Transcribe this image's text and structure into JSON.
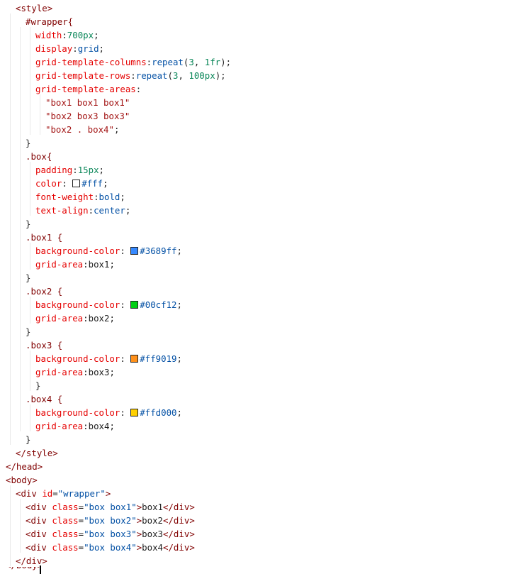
{
  "lines": [
    {
      "parts": [
        {
          "t": "<style>",
          "c": "tag"
        }
      ]
    },
    {
      "parts": [
        {
          "t": "#wrapper{",
          "c": "sel"
        }
      ]
    },
    {
      "parts": [
        {
          "t": "width",
          "c": "prop"
        },
        {
          "t": ":",
          "c": "pun"
        },
        {
          "t": "700px",
          "c": "num"
        },
        {
          "t": ";",
          "c": "pun"
        }
      ]
    },
    {
      "parts": [
        {
          "t": "display",
          "c": "prop"
        },
        {
          "t": ":",
          "c": "pun"
        },
        {
          "t": "grid",
          "c": "val"
        },
        {
          "t": ";",
          "c": "pun"
        }
      ]
    },
    {
      "parts": [
        {
          "t": "grid-template-columns",
          "c": "prop"
        },
        {
          "t": ":",
          "c": "pun"
        },
        {
          "t": "repeat",
          "c": "val"
        },
        {
          "t": "(",
          "c": "pun"
        },
        {
          "t": "3",
          "c": "num"
        },
        {
          "t": ", ",
          "c": "pun"
        },
        {
          "t": "1fr",
          "c": "num"
        },
        {
          "t": ");",
          "c": "pun"
        }
      ]
    },
    {
      "parts": [
        {
          "t": "grid-template-rows",
          "c": "prop"
        },
        {
          "t": ":",
          "c": "pun"
        },
        {
          "t": "repeat",
          "c": "val"
        },
        {
          "t": "(",
          "c": "pun"
        },
        {
          "t": "3",
          "c": "num"
        },
        {
          "t": ", ",
          "c": "pun"
        },
        {
          "t": "100px",
          "c": "num"
        },
        {
          "t": ");",
          "c": "pun"
        }
      ]
    },
    {
      "parts": [
        {
          "t": "grid-template-areas",
          "c": "prop"
        },
        {
          "t": ":",
          "c": "pun"
        }
      ]
    },
    {
      "parts": [
        {
          "t": "\"box1 box1 box1\"",
          "c": "str"
        }
      ]
    },
    {
      "parts": [
        {
          "t": "\"box2 box3 box3\"",
          "c": "str"
        }
      ]
    },
    {
      "parts": [
        {
          "t": "\"box2 . box4\"",
          "c": "str"
        },
        {
          "t": ";",
          "c": "pun"
        }
      ]
    },
    {
      "parts": [
        {
          "t": "}",
          "c": "pun"
        }
      ]
    },
    {
      "parts": [
        {
          "t": ".box{",
          "c": "sel"
        }
      ]
    },
    {
      "parts": [
        {
          "t": "padding",
          "c": "prop"
        },
        {
          "t": ":",
          "c": "pun"
        },
        {
          "t": "15px",
          "c": "num"
        },
        {
          "t": ";",
          "c": "pun"
        }
      ]
    },
    {
      "parts": [
        {
          "t": "color",
          "c": "prop"
        },
        {
          "t": ": ",
          "c": "pun"
        },
        {
          "swatch": "#ffffff"
        },
        {
          "t": "#fff",
          "c": "val"
        },
        {
          "t": ";",
          "c": "pun"
        }
      ]
    },
    {
      "parts": [
        {
          "t": "font-weight",
          "c": "prop"
        },
        {
          "t": ":",
          "c": "pun"
        },
        {
          "t": "bold",
          "c": "val"
        },
        {
          "t": ";",
          "c": "pun"
        }
      ]
    },
    {
      "parts": [
        {
          "t": "text-align",
          "c": "prop"
        },
        {
          "t": ":",
          "c": "pun"
        },
        {
          "t": "center",
          "c": "val"
        },
        {
          "t": ";",
          "c": "pun"
        }
      ]
    },
    {
      "parts": [
        {
          "t": "}",
          "c": "pun"
        }
      ]
    },
    {
      "parts": [
        {
          "t": ".box1 {",
          "c": "sel"
        }
      ]
    },
    {
      "parts": [
        {
          "t": "background-color",
          "c": "prop"
        },
        {
          "t": ": ",
          "c": "pun"
        },
        {
          "swatch": "#3689ff"
        },
        {
          "t": "#3689ff",
          "c": "val"
        },
        {
          "t": ";",
          "c": "pun"
        }
      ]
    },
    {
      "parts": [
        {
          "t": "grid-area",
          "c": "prop"
        },
        {
          "t": ":",
          "c": "pun"
        },
        {
          "t": "box1",
          "c": "txt"
        },
        {
          "t": ";",
          "c": "pun"
        }
      ]
    },
    {
      "parts": [
        {
          "t": "}",
          "c": "pun"
        }
      ]
    },
    {
      "parts": [
        {
          "t": ".box2 {",
          "c": "sel"
        }
      ]
    },
    {
      "parts": [
        {
          "t": "background-color",
          "c": "prop"
        },
        {
          "t": ": ",
          "c": "pun"
        },
        {
          "swatch": "#00cf12"
        },
        {
          "t": "#00cf12",
          "c": "val"
        },
        {
          "t": ";",
          "c": "pun"
        }
      ]
    },
    {
      "parts": [
        {
          "t": "grid-area",
          "c": "prop"
        },
        {
          "t": ":",
          "c": "pun"
        },
        {
          "t": "box2",
          "c": "txt"
        },
        {
          "t": ";",
          "c": "pun"
        }
      ]
    },
    {
      "parts": [
        {
          "t": "}",
          "c": "pun"
        }
      ]
    },
    {
      "parts": [
        {
          "t": ".box3 {",
          "c": "sel"
        }
      ]
    },
    {
      "parts": [
        {
          "t": "background-color",
          "c": "prop"
        },
        {
          "t": ": ",
          "c": "pun"
        },
        {
          "swatch": "#ff9019"
        },
        {
          "t": "#ff9019",
          "c": "val"
        },
        {
          "t": ";",
          "c": "pun"
        }
      ]
    },
    {
      "parts": [
        {
          "t": "grid-area",
          "c": "prop"
        },
        {
          "t": ":",
          "c": "pun"
        },
        {
          "t": "box3",
          "c": "txt"
        },
        {
          "t": ";",
          "c": "pun"
        }
      ]
    },
    {
      "parts": [
        {
          "t": "}",
          "c": "pun"
        }
      ]
    },
    {
      "parts": [
        {
          "t": ".box4 {",
          "c": "sel"
        }
      ]
    },
    {
      "parts": [
        {
          "t": "background-color",
          "c": "prop"
        },
        {
          "t": ": ",
          "c": "pun"
        },
        {
          "swatch": "#ffd000"
        },
        {
          "t": "#ffd000",
          "c": "val"
        },
        {
          "t": ";",
          "c": "pun"
        }
      ]
    },
    {
      "parts": [
        {
          "t": "grid-area",
          "c": "prop"
        },
        {
          "t": ":",
          "c": "pun"
        },
        {
          "t": "box4",
          "c": "txt"
        },
        {
          "t": ";",
          "c": "pun"
        }
      ]
    },
    {
      "parts": [
        {
          "t": "}",
          "c": "pun"
        }
      ]
    },
    {
      "parts": [
        {
          "t": "</style>",
          "c": "tag"
        }
      ]
    },
    {
      "parts": [
        {
          "t": "</head>",
          "c": "tag"
        }
      ]
    },
    {
      "parts": [
        {
          "t": "<body>",
          "c": "tag"
        }
      ]
    },
    {
      "parts": [
        {
          "t": "<div ",
          "c": "tag"
        },
        {
          "t": "id",
          "c": "attr"
        },
        {
          "t": "=",
          "c": "pun"
        },
        {
          "t": "\"wrapper\"",
          "c": "val"
        },
        {
          "t": ">",
          "c": "tag"
        }
      ]
    },
    {
      "parts": [
        {
          "t": "<div ",
          "c": "tag"
        },
        {
          "t": "class",
          "c": "attr"
        },
        {
          "t": "=",
          "c": "pun"
        },
        {
          "t": "\"box box1\"",
          "c": "val"
        },
        {
          "t": ">",
          "c": "tag"
        },
        {
          "t": "box1",
          "c": "txt"
        },
        {
          "t": "</div>",
          "c": "tag"
        }
      ]
    },
    {
      "parts": [
        {
          "t": "<div ",
          "c": "tag"
        },
        {
          "t": "class",
          "c": "attr"
        },
        {
          "t": "=",
          "c": "pun"
        },
        {
          "t": "\"box box2\"",
          "c": "val"
        },
        {
          "t": ">",
          "c": "tag"
        },
        {
          "t": "box2",
          "c": "txt"
        },
        {
          "t": "</div>",
          "c": "tag"
        }
      ]
    },
    {
      "parts": [
        {
          "t": "<div ",
          "c": "tag"
        },
        {
          "t": "class",
          "c": "attr"
        },
        {
          "t": "=",
          "c": "pun"
        },
        {
          "t": "\"box box3\"",
          "c": "val"
        },
        {
          "t": ">",
          "c": "tag"
        },
        {
          "t": "box3",
          "c": "txt"
        },
        {
          "t": "</div>",
          "c": "tag"
        }
      ]
    },
    {
      "parts": [
        {
          "t": "<div ",
          "c": "tag"
        },
        {
          "t": "class",
          "c": "attr"
        },
        {
          "t": "=",
          "c": "pun"
        },
        {
          "t": "\"box box4\"",
          "c": "val"
        },
        {
          "t": ">",
          "c": "tag"
        },
        {
          "t": "box4",
          "c": "txt"
        },
        {
          "t": "</div>",
          "c": "tag"
        }
      ]
    },
    {
      "parts": [
        {
          "t": "</div>",
          "c": "tag"
        }
      ]
    }
  ]
}
